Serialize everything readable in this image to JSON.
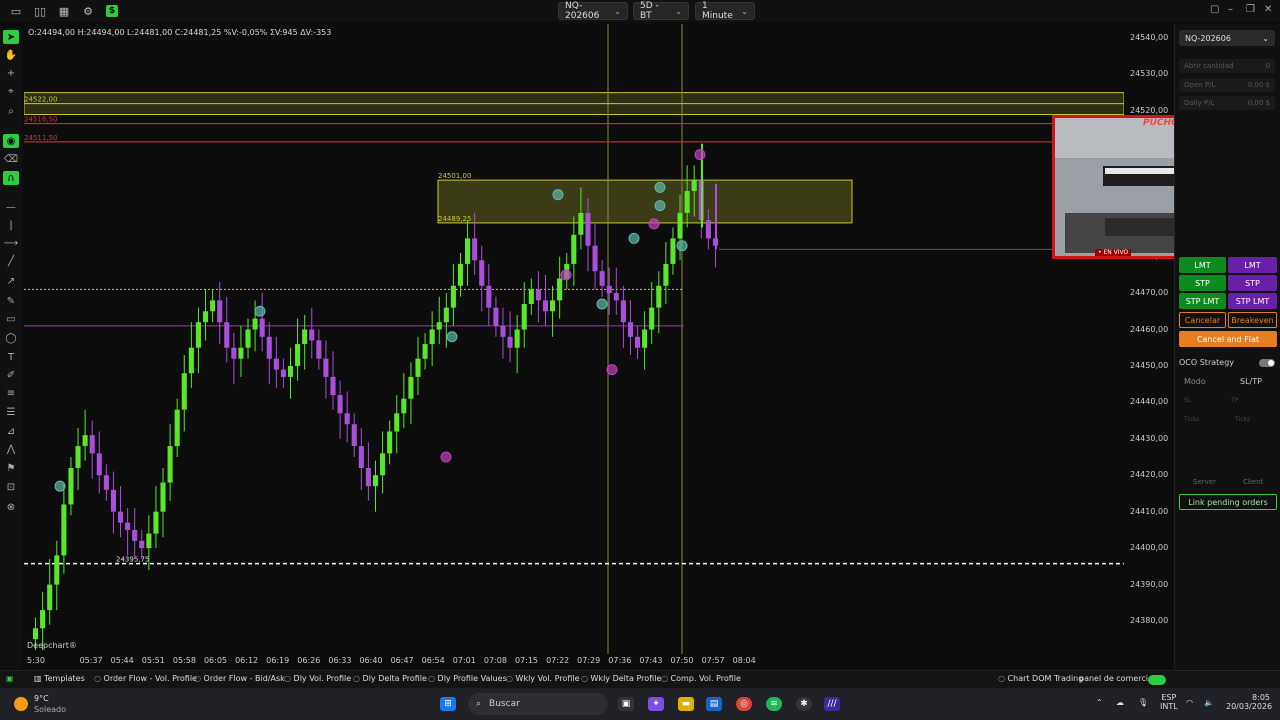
{
  "topbar": {
    "symbol": "NQ-202606",
    "template": "5D - BT",
    "timeframe": "1 Minute",
    "app_icon": "dollar-icon"
  },
  "ohlc": {
    "text": "O:24494,00  H:24494,00  L:24481,00  C:24481,25  %V:-0,05%  ΣV:945  ΔV:-353"
  },
  "chart_data": {
    "type": "candlestick",
    "symbol": "NQ-202606",
    "timeframe": "1 Minute",
    "ylim": [
      24375,
      24545
    ],
    "y_ticks": [
      "24540,00",
      "24530,00",
      "24520,00",
      "24510,00",
      "24500,00",
      "24490,00",
      "24480,00",
      "24470,00",
      "24460,00",
      "24450,00",
      "24440,00",
      "24430,00",
      "24420,00",
      "24410,00",
      "24400,00",
      "24390,00",
      "24380,00"
    ],
    "x_ticks": [
      "5:30",
      "05:37",
      "05:44",
      "05:51",
      "05:58",
      "06:05",
      "06:12",
      "06:19",
      "06:26",
      "06:33",
      "06:40",
      "06:47",
      "06:54",
      "07:01",
      "07:08",
      "07:15",
      "07:22",
      "07:29",
      "07:36",
      "07:43",
      "07:50",
      "07:57",
      "08:04"
    ],
    "levels": [
      {
        "label": "24522,00",
        "price": 24522.0,
        "color": "#c8c832"
      },
      {
        "label": "24516,50",
        "price": 24516.5,
        "color": "#e03030"
      },
      {
        "label": "24511,50",
        "price": 24511.5,
        "color": "#e03030"
      },
      {
        "label": "24501,00",
        "price": 24501.0,
        "color": "#c8c832"
      },
      {
        "label": "24489,25",
        "price": 24489.25,
        "color": "#c8c832"
      },
      {
        "label": "24395,75",
        "price": 24395.75,
        "color": "#ffffff"
      }
    ],
    "zone": {
      "high": 24501.0,
      "low": 24489.25
    },
    "closes": [
      24378,
      24383,
      24390,
      24398,
      24412,
      24422,
      24428,
      24431,
      24426,
      24420,
      24416,
      24410,
      24407,
      24405,
      24402,
      24400,
      24404,
      24410,
      24418,
      24428,
      24438,
      24448,
      24455,
      24462,
      24465,
      24468,
      24462,
      24455,
      24452,
      24455,
      24460,
      24463,
      24458,
      24452,
      24449,
      24447,
      24450,
      24456,
      24460,
      24457,
      24452,
      24447,
      24442,
      24437,
      24434,
      24428,
      24422,
      24417,
      24420,
      24426,
      24432,
      24437,
      24441,
      24447,
      24452,
      24456,
      24460,
      24462,
      24466,
      24472,
      24478,
      24485,
      24479,
      24472,
      24466,
      24461,
      24458,
      24455,
      24460,
      24467,
      24471,
      24468,
      24465,
      24468,
      24474,
      24478,
      24486,
      24492,
      24483,
      24476,
      24472,
      24470,
      24468,
      24462,
      24458,
      24455,
      24460,
      24466,
      24472,
      24478,
      24485,
      24492,
      24498,
      24501,
      24490,
      24485,
      24483
    ],
    "up_color": "#5ae62a",
    "down_color": "#a94fd9"
  },
  "axis": {
    "y": [
      "24540,00",
      "24530,00",
      "24520,00",
      "24510,00",
      "24500,00",
      "24490,00",
      "24480,00",
      "24470,00",
      "24460,00",
      "24450,00",
      "24440,00",
      "24430,00",
      "24420,00",
      "24410,00",
      "24400,00",
      "24390,00",
      "24380,00"
    ],
    "x": [
      "5:30",
      "05:37",
      "05:44",
      "05:51",
      "05:58",
      "06:05",
      "06:12",
      "06:19",
      "06:26",
      "06:33",
      "06:40",
      "06:47",
      "06:54",
      "07:01",
      "07:08",
      "07:15",
      "07:22",
      "07:29",
      "07:36",
      "07:43",
      "07:50",
      "07:57",
      "08:04"
    ]
  },
  "levels_text": {
    "l1": "24522,00",
    "l2": "24516,50",
    "l3": "24511,50",
    "l4": "24501,00",
    "l5": "24489,25",
    "l6": "24395,75"
  },
  "watermark": "Deepchart®",
  "right_panel": {
    "symbol": "NQ-202606",
    "qty_label": "Abrir cantidad",
    "qty_value": "0",
    "open_pl_label": "Open P/L",
    "open_pl_value": "0,00 $",
    "daily_pl_label": "Daily P/L",
    "daily_pl_value": "0,00 $",
    "btn_lmt_buy": "LMT",
    "btn_lmt_sell": "LMT",
    "btn_stp_buy": "STP",
    "btn_stp_sell": "STP",
    "btn_stplmt_buy": "STP LMT",
    "btn_stplmt_sell": "STP LMT",
    "btn_cancel": "Cancelar",
    "btn_breakeven": "Breakeven",
    "btn_cancel_flat": "Cancel and Flat",
    "oco_label": "OCO Strategy",
    "mode_label": "Modo",
    "mode_value": "SL/TP",
    "sl": "SL",
    "tp": "TP",
    "ticks1": "Ticks",
    "ticks2": "Ticks",
    "server": "Server",
    "client": "Client",
    "link_pending": "Link pending orders"
  },
  "webcam": {
    "title": "PUCHO",
    "live": "• EN VIVO"
  },
  "templates_bar": {
    "label": "Templates",
    "items": [
      "Order Flow - Vol. Profile",
      "Order Flow - Bid/Ask",
      "Dly Vol. Profile",
      "Dly Delta Profile",
      "Dly Profile Values",
      "Wkly Vol. Profile",
      "Wkly Delta Profile",
      "Comp. Vol. Profile"
    ],
    "chart_dom": "Chart DOM Trading",
    "panel": "panel de comercio"
  },
  "taskbar": {
    "weather_temp": "9°C",
    "weather_desc": "Soleado",
    "search": "Buscar",
    "lang1": "ESP",
    "lang2": "INTL",
    "time": "8:05",
    "date": "20/03/2026"
  }
}
